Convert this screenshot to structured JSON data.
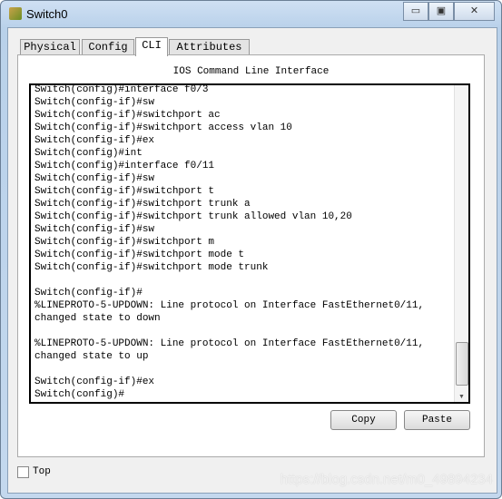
{
  "window": {
    "title": "Switch0",
    "minimize": "▭",
    "maximize": "▣",
    "close": "✕"
  },
  "tabs": [
    {
      "label": "Physical"
    },
    {
      "label": "Config"
    },
    {
      "label": "CLI",
      "active": true
    },
    {
      "label": "Attributes"
    }
  ],
  "cli": {
    "header": "IOS Command Line Interface",
    "lines": [
      "Switch(config)#interface f0/3",
      "Switch(config-if)#sw",
      "Switch(config-if)#switchport ac",
      "Switch(config-if)#switchport access vlan 10",
      "Switch(config-if)#ex",
      "Switch(config)#int",
      "Switch(config)#interface f0/11",
      "Switch(config-if)#sw",
      "Switch(config-if)#switchport t",
      "Switch(config-if)#switchport trunk a",
      "Switch(config-if)#switchport trunk allowed vlan 10,20",
      "Switch(config-if)#sw",
      "Switch(config-if)#switchport m",
      "Switch(config-if)#switchport mode t",
      "Switch(config-if)#switchport mode trunk",
      "",
      "Switch(config-if)#",
      "%LINEPROTO-5-UPDOWN: Line protocol on Interface FastEthernet0/11,",
      "changed state to down",
      "",
      "%LINEPROTO-5-UPDOWN: Line protocol on Interface FastEthernet0/11,",
      "changed state to up",
      "",
      "Switch(config-if)#ex",
      "Switch(config)#"
    ],
    "scroll_position": 0.95
  },
  "buttons": {
    "copy": "Copy",
    "paste": "Paste"
  },
  "top_checkbox": {
    "label": "Top",
    "checked": false
  },
  "watermark": "https://blog.csdn.net/m0_49894234"
}
